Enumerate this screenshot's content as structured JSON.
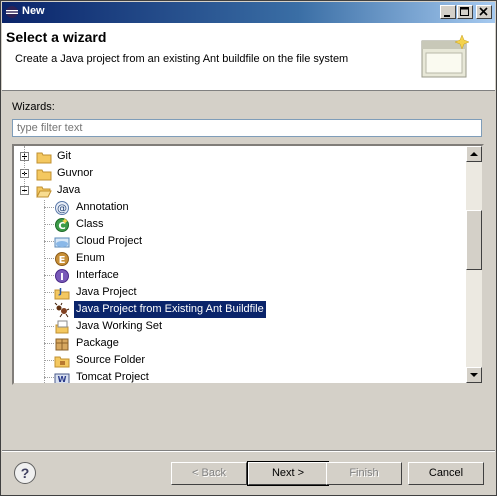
{
  "window": {
    "title": "New"
  },
  "banner": {
    "heading": "Select a wizard",
    "description": "Create a Java project from an existing Ant buildfile on the file system"
  },
  "wizards_label": "Wizards:",
  "filter": {
    "placeholder": "type filter text",
    "value": ""
  },
  "tree": {
    "categories": [
      {
        "label": "Git",
        "expanded": false
      },
      {
        "label": "Guvnor",
        "expanded": false
      },
      {
        "label": "Java",
        "expanded": true
      }
    ],
    "java_items": [
      {
        "label": "Annotation",
        "icon": "annotation-icon"
      },
      {
        "label": "Class",
        "icon": "class-icon"
      },
      {
        "label": "Cloud Project",
        "icon": "cloud-project-icon"
      },
      {
        "label": "Enum",
        "icon": "enum-icon"
      },
      {
        "label": "Interface",
        "icon": "interface-icon"
      },
      {
        "label": "Java Project",
        "icon": "java-project-icon"
      },
      {
        "label": "Java Project from Existing Ant Buildfile",
        "icon": "ant-icon",
        "selected": true
      },
      {
        "label": "Java Working Set",
        "icon": "working-set-icon"
      },
      {
        "label": "Package",
        "icon": "package-icon"
      },
      {
        "label": "Source Folder",
        "icon": "source-folder-icon"
      },
      {
        "label": "Tomcat Project",
        "icon": "tomcat-icon"
      }
    ]
  },
  "buttons": {
    "back": "< Back",
    "next": "Next >",
    "finish": "Finish",
    "cancel": "Cancel"
  },
  "colors": {
    "selection": "#0a246a",
    "titlebar": "#0a246a"
  }
}
